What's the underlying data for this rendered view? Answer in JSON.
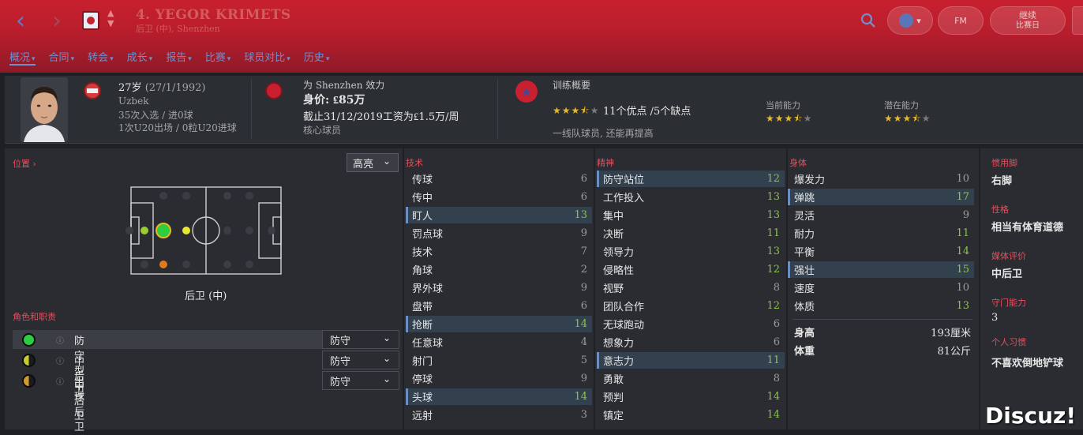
{
  "header": {
    "player_name": "4. YEGOR KRIMETS",
    "player_subtitle": "后卫 (中), Shenzhen",
    "nav_back_glyph": "‹",
    "nav_forward_glyph": "›"
  },
  "tabs": [
    {
      "label": "概况"
    },
    {
      "label": "合同"
    },
    {
      "label": "转会"
    },
    {
      "label": "成长"
    },
    {
      "label": "报告"
    },
    {
      "label": "比赛"
    },
    {
      "label": "球员对比"
    },
    {
      "label": "历史"
    }
  ],
  "topbar_buttons": {
    "club_label": "▾",
    "fm_label": "FM",
    "continue_label": "继续",
    "continue_sub": "比赛日"
  },
  "info": {
    "age": "27岁",
    "dob": "(27/1/1992)",
    "nationality": "Uzbek",
    "caps": "35次入选 / 进0球",
    "u20": "1次U20出场 / 0粒U20进球",
    "club_line": "为 Shenzhen 效力",
    "value": "身价: ₤85万",
    "contract": "截止31/12/2019工资为₤1.5万/周",
    "squad_status": "核心球员",
    "training_title": "训练概要",
    "strengths": "11个优点 /5个缺点",
    "training_note": "一线队球员, 还能再提高",
    "current_ability_label": "当前能力",
    "potential_ability_label": "潜在能力",
    "training_stars": 3.5,
    "current_stars": 3.5,
    "potential_stars": 3.5
  },
  "left": {
    "position_header": "位置 ›",
    "highlight_label": "高亮",
    "position_caption": "后卫 (中)",
    "roles_header": "角色和职责",
    "roles": [
      {
        "name": "防守型中后卫",
        "duty": "防守",
        "rating": "full",
        "color": "#2ecc40"
      },
      {
        "name": "中后卫",
        "duty": "防守",
        "rating": "half",
        "color": "#c8cc2e"
      },
      {
        "name": "出球后卫",
        "duty": "防守",
        "rating": "half",
        "color": "#d49a2e"
      }
    ]
  },
  "technical": {
    "header": "技术",
    "rows": [
      {
        "name": "传球",
        "value": "6",
        "hl": false,
        "green": false
      },
      {
        "name": "传中",
        "value": "6",
        "hl": false,
        "green": false
      },
      {
        "name": "盯人",
        "value": "13",
        "hl": true,
        "green": true
      },
      {
        "name": "罚点球",
        "value": "9",
        "hl": false,
        "green": false
      },
      {
        "name": "技术",
        "value": "7",
        "hl": false,
        "green": false
      },
      {
        "name": "角球",
        "value": "2",
        "hl": false,
        "green": false
      },
      {
        "name": "界外球",
        "value": "9",
        "hl": false,
        "green": false
      },
      {
        "name": "盘带",
        "value": "6",
        "hl": false,
        "green": false
      },
      {
        "name": "抢断",
        "value": "14",
        "hl": true,
        "green": true
      },
      {
        "name": "任意球",
        "value": "4",
        "hl": false,
        "green": false
      },
      {
        "name": "射门",
        "value": "5",
        "hl": false,
        "green": false
      },
      {
        "name": "停球",
        "value": "9",
        "hl": false,
        "green": false
      },
      {
        "name": "头球",
        "value": "14",
        "hl": true,
        "green": true
      },
      {
        "name": "远射",
        "value": "3",
        "hl": false,
        "green": false
      }
    ]
  },
  "mental": {
    "header": "精神",
    "rows": [
      {
        "name": "防守站位",
        "value": "12",
        "hl": true,
        "green": true
      },
      {
        "name": "工作投入",
        "value": "13",
        "hl": false,
        "green": true
      },
      {
        "name": "集中",
        "value": "13",
        "hl": false,
        "green": true
      },
      {
        "name": "决断",
        "value": "11",
        "hl": false,
        "green": true
      },
      {
        "name": "领导力",
        "value": "13",
        "hl": false,
        "green": true
      },
      {
        "name": "侵略性",
        "value": "12",
        "hl": false,
        "green": true
      },
      {
        "name": "视野",
        "value": "8",
        "hl": false,
        "green": false
      },
      {
        "name": "团队合作",
        "value": "12",
        "hl": false,
        "green": true
      },
      {
        "name": "无球跑动",
        "value": "6",
        "hl": false,
        "green": false
      },
      {
        "name": "想象力",
        "value": "6",
        "hl": false,
        "green": false
      },
      {
        "name": "意志力",
        "value": "11",
        "hl": true,
        "green": true
      },
      {
        "name": "勇敢",
        "value": "8",
        "hl": false,
        "green": false
      },
      {
        "name": "预判",
        "value": "14",
        "hl": false,
        "green": true
      },
      {
        "name": "镇定",
        "value": "14",
        "hl": false,
        "green": true
      }
    ]
  },
  "physical": {
    "header": "身体",
    "rows": [
      {
        "name": "爆发力",
        "value": "10",
        "hl": false,
        "green": false
      },
      {
        "name": "弹跳",
        "value": "17",
        "hl": true,
        "green": true
      },
      {
        "name": "灵活",
        "value": "9",
        "hl": false,
        "green": false
      },
      {
        "name": "耐力",
        "value": "11",
        "hl": false,
        "green": true
      },
      {
        "name": "平衡",
        "value": "14",
        "hl": false,
        "green": true
      },
      {
        "name": "强壮",
        "value": "15",
        "hl": true,
        "green": true
      },
      {
        "name": "速度",
        "value": "10",
        "hl": false,
        "green": false
      },
      {
        "name": "体质",
        "value": "13",
        "hl": false,
        "green": true
      }
    ],
    "height_label": "身高",
    "height_value": "193厘米",
    "weight_label": "体重",
    "weight_value": "81公斤"
  },
  "side": {
    "foot_label": "惯用脚",
    "foot_value": "右脚",
    "personality_label": "性格",
    "personality_value": "相当有体育道德",
    "media_label": "媒体评价",
    "media_value": "中后卫",
    "gk_label": "守门能力",
    "gk_value": "3",
    "habits_label": "个人习惯",
    "habits_value": "不喜欢倒地铲球"
  },
  "watermark": "Discuz!",
  "colors": {
    "accent_red": "#c8202e",
    "header_red": "#e94d5c",
    "value_green": "#8bc34a",
    "star": "#e8b923",
    "link_blue": "#6e8fd0"
  }
}
